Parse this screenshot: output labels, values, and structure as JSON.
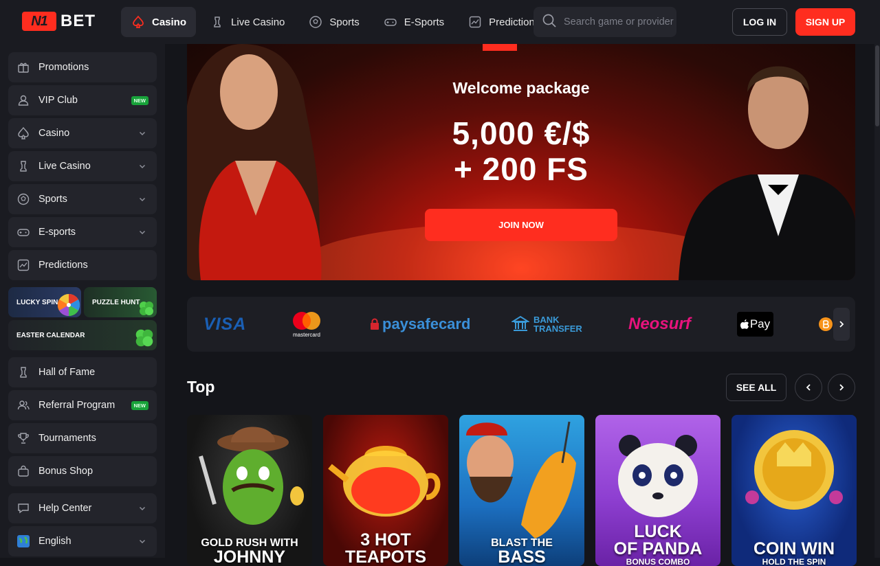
{
  "brand": {
    "logo_mark": "N1",
    "logo_text": "BET"
  },
  "nav": [
    {
      "label": "Casino",
      "icon": "spade-icon",
      "active": true
    },
    {
      "label": "Live Casino",
      "icon": "chess-icon"
    },
    {
      "label": "Sports",
      "icon": "football-icon"
    },
    {
      "label": "E-Sports",
      "icon": "gamepad-icon"
    },
    {
      "label": "Predictions",
      "icon": "chart-icon"
    }
  ],
  "search": {
    "placeholder": "Search game or provider"
  },
  "auth": {
    "login": "LOG IN",
    "signup": "SIGN UP"
  },
  "sidebar": {
    "items": [
      {
        "label": "Promotions",
        "icon": "gift-icon"
      },
      {
        "label": "VIP Club",
        "icon": "user-icon",
        "badge": "NEW"
      },
      {
        "label": "Casino",
        "icon": "spade-icon",
        "expandable": true
      },
      {
        "label": "Live Casino",
        "icon": "chess-icon",
        "expandable": true
      },
      {
        "label": "Sports",
        "icon": "football-icon",
        "expandable": true
      },
      {
        "label": "E-sports",
        "icon": "gamepad-icon",
        "expandable": true
      },
      {
        "label": "Predictions",
        "icon": "chart-icon"
      }
    ],
    "tiles": [
      {
        "label": "LUCKY SPIN"
      },
      {
        "label": "PUZZLE HUNT"
      },
      {
        "label": "EASTER CALENDAR"
      }
    ],
    "items2": [
      {
        "label": "Hall of Fame",
        "icon": "crown-icon"
      },
      {
        "label": "Referral Program",
        "icon": "users-icon",
        "badge": "NEW"
      },
      {
        "label": "Tournaments",
        "icon": "trophy-icon"
      },
      {
        "label": "Bonus Shop",
        "icon": "bag-icon"
      }
    ],
    "help": {
      "label": "Help Center",
      "icon": "chat-icon"
    },
    "language": {
      "label": "English",
      "icon": "globe-icon"
    }
  },
  "hero": {
    "title": "Welcome package",
    "amount_line1": "5,000 €/$",
    "amount_line2": "+ 200 FS",
    "cta": "JOIN NOW"
  },
  "payments": [
    {
      "name": "VISA"
    },
    {
      "name": "mastercard"
    },
    {
      "name": "paysafecard"
    },
    {
      "name": "BANK TRANSFER"
    },
    {
      "name": "Neosurf"
    },
    {
      "name": "Pay"
    }
  ],
  "top_section": {
    "title": "Top",
    "see_all": "SEE ALL",
    "games": [
      {
        "line1": "GOLD RUSH WITH",
        "line2": "JOHNNY",
        "line3": ""
      },
      {
        "line1": "",
        "line2": "3 HOT",
        "line3": "TEAPOTS"
      },
      {
        "line1": "BLAST THE",
        "line2": "BASS",
        "line3": ""
      },
      {
        "line1": "LUCK",
        "line2": "OF PANDA",
        "line3": "BONUS COMBO"
      },
      {
        "line1": "",
        "line2": "COIN WIN",
        "line3": "HOLD THE SPIN"
      }
    ]
  },
  "colors": {
    "accent": "#ff2d1f",
    "bg": "#14151a",
    "panel": "#1a1b21",
    "badge": "#18a23a"
  }
}
